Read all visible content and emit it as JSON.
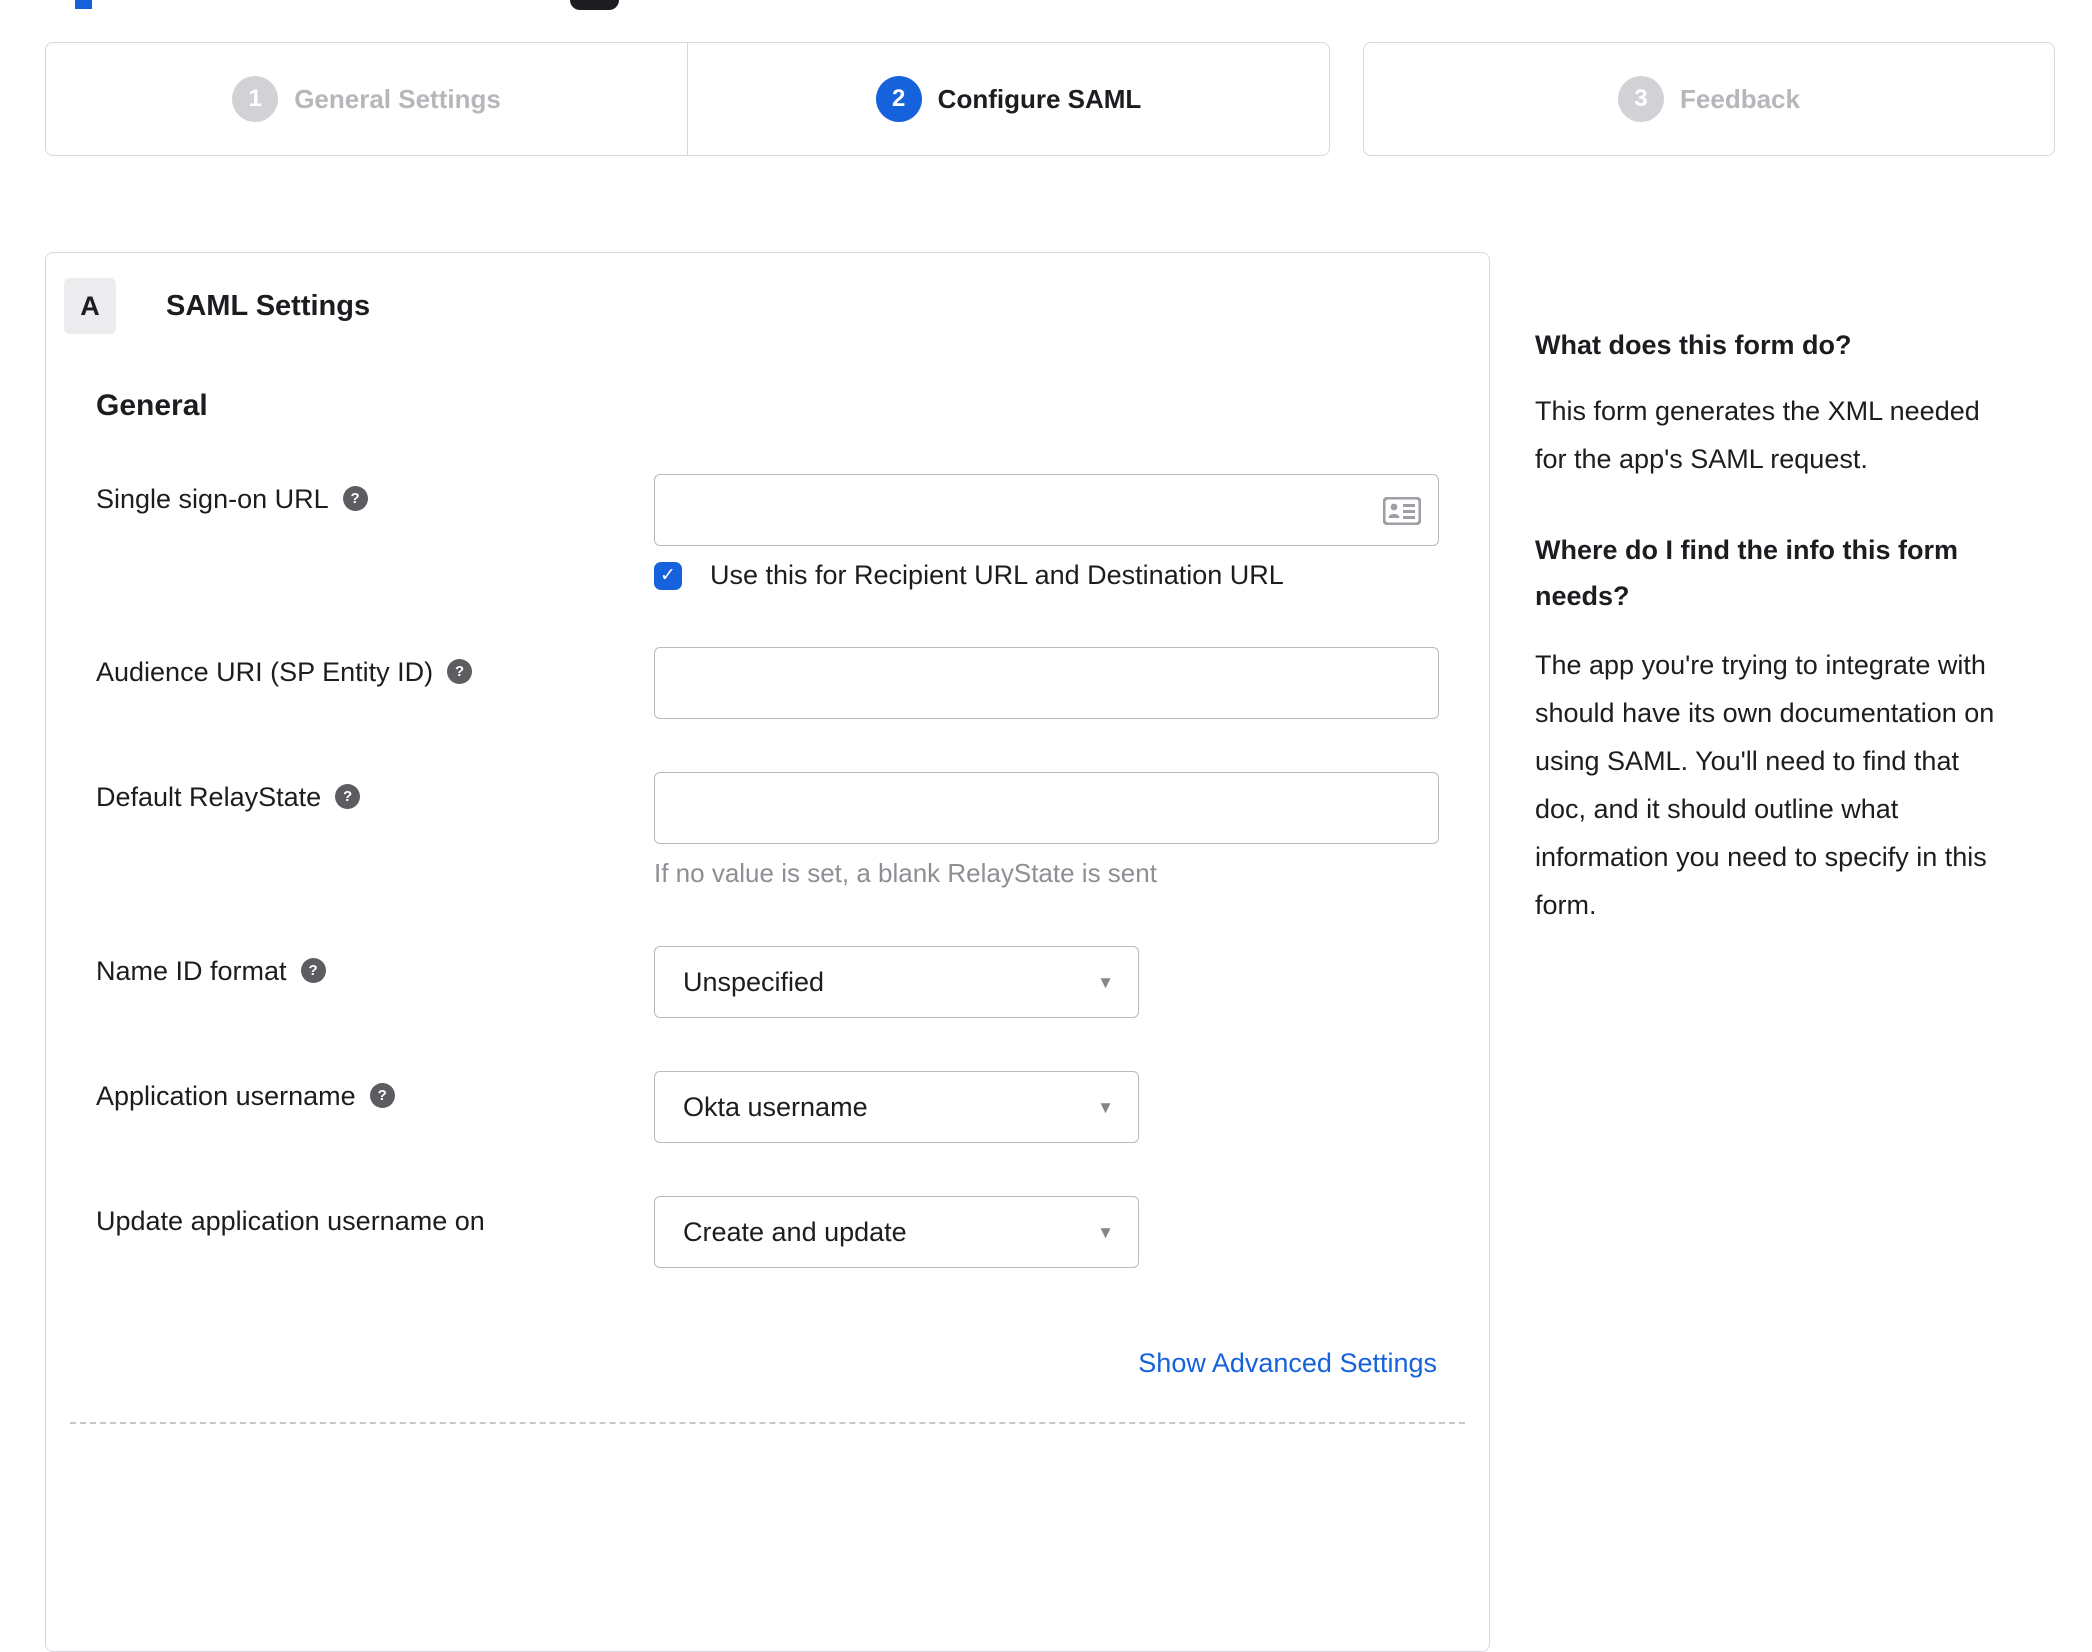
{
  "icons": {
    "help": "?",
    "check": "✓",
    "dropdown_arrow": "▼"
  },
  "colors": {
    "accent_blue": "#1662dd",
    "dark_text": "#1d1d21",
    "inactive_gray": "#b6b6bb",
    "panel_border": "#d7d7dc",
    "input_border": "#b9b9be",
    "hint_gray": "#8e8e94"
  },
  "stepper": {
    "steps": [
      {
        "number": "1",
        "label": "General Settings",
        "state": "inactive"
      },
      {
        "number": "2",
        "label": "Configure SAML",
        "state": "active"
      },
      {
        "number": "3",
        "label": "Feedback",
        "state": "inactive"
      }
    ]
  },
  "panel": {
    "badge": "A",
    "title": "SAML Settings",
    "section": "General",
    "fields": {
      "sso": {
        "label": "Single sign-on URL",
        "value": "",
        "checkbox_label": "Use this for Recipient URL and Destination URL",
        "checkbox_checked": true
      },
      "audience": {
        "label": "Audience URI (SP Entity ID)",
        "value": ""
      },
      "relay": {
        "label": "Default RelayState",
        "value": "",
        "hint": "If no value is set, a blank RelayState is sent"
      },
      "nameid": {
        "label": "Name ID format",
        "value": "Unspecified"
      },
      "appuser": {
        "label": "Application username",
        "value": "Okta username"
      },
      "updateuser": {
        "label": "Update application username on",
        "value": "Create and update"
      }
    },
    "advanced_link": "Show Advanced Settings"
  },
  "sidebar": {
    "heading1": "What does this form do?",
    "para1": "This form generates the XML needed for the app's SAML request.",
    "heading2": "Where do I find the info this form needs?",
    "para2": "The app you're trying to integrate with should have its own documentation on using SAML. You'll need to find that doc, and it should outline what information you need to specify in this form."
  }
}
